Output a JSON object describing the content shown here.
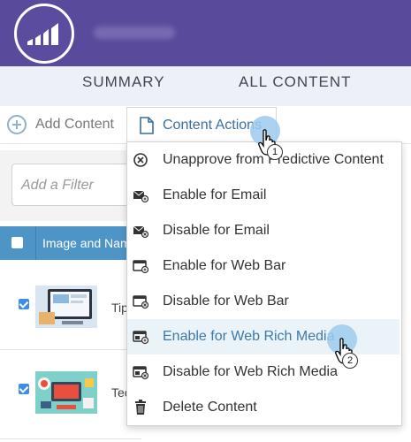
{
  "header": {
    "bg_color": "#5a4a9c",
    "logo_icon": "bar-chart-logo"
  },
  "tabs": [
    {
      "label": "SUMMARY"
    },
    {
      "label": "ALL CONTENT"
    }
  ],
  "toolbar": {
    "add_label": "Add Content",
    "actions_label": "Content Actions"
  },
  "filter": {
    "placeholder": "Add a Filter"
  },
  "table": {
    "header_label": "Image and Nam",
    "rows": [
      {
        "text": "Tip"
      },
      {
        "text": "Tec"
      }
    ]
  },
  "menu": {
    "items": [
      {
        "label": "Unapprove from Predictive Content",
        "icon": "x-circle-icon"
      },
      {
        "label": "Enable for Email",
        "icon": "email-enable-icon"
      },
      {
        "label": "Disable for Email",
        "icon": "email-disable-icon"
      },
      {
        "label": "Enable for Web Bar",
        "icon": "web-bar-enable-icon"
      },
      {
        "label": "Disable for Web Bar",
        "icon": "web-bar-disable-icon"
      },
      {
        "label": "Enable for Web Rich Media",
        "icon": "rich-media-enable-icon"
      },
      {
        "label": "Disable for Web Rich Media",
        "icon": "rich-media-disable-icon"
      },
      {
        "label": "Delete Content",
        "icon": "trash-icon"
      }
    ]
  },
  "callouts": [
    {
      "number": "1"
    },
    {
      "number": "2"
    }
  ]
}
